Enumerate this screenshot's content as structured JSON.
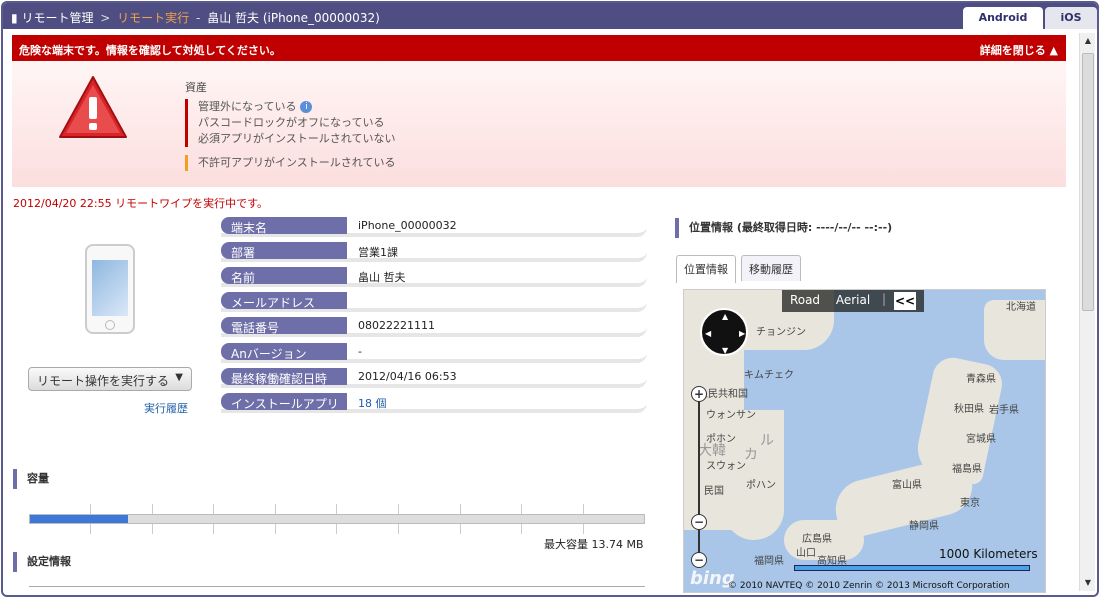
{
  "titlebar": {
    "crumb_root": "リモート管理",
    "crumb_sep": ">",
    "crumb_current": "リモート実行",
    "crumb_dash": "-",
    "device_title": "畠山 哲夫 (iPhone_00000032)"
  },
  "os_tabs": [
    "Android",
    "iOS"
  ],
  "alert": {
    "message": "危険な端末です。情報を確認して対処してください。",
    "close_label": "詳細を閉じる ▲",
    "section_title": "資産",
    "issues_red": [
      "管理外になっている",
      "パスコードロックがオフになっている",
      "必須アプリがインストールされていない"
    ],
    "issues_orange": [
      "不許可アプリがインストールされている"
    ]
  },
  "wipe_message": "2012/04/20 22:55 リモートワイプを実行中です。",
  "remote_action": {
    "label": "リモート操作を実行する",
    "caret": "▼",
    "history_link": "実行履歴"
  },
  "device_info": [
    {
      "label": "端末名",
      "value": "iPhone_00000032"
    },
    {
      "label": "部署",
      "value": "営業1課"
    },
    {
      "label": "名前",
      "value": "畠山 哲夫"
    },
    {
      "label": "メールアドレス",
      "value": ""
    },
    {
      "label": "電話番号",
      "value": "08022221111"
    },
    {
      "label": "Anバージョン",
      "value": "-"
    },
    {
      "label": "最終稼働確認日時",
      "value": "2012/04/16 06:53"
    },
    {
      "label": "インストールアプリ",
      "value": "18 個"
    }
  ],
  "capacity": {
    "title": "容量",
    "used_fraction": 0.16,
    "max_label": "最大容量 13.74 MB"
  },
  "settings": {
    "title": "設定情報"
  },
  "location": {
    "title": "位置情報 (最終取得日時: ----/--/-- --:--)",
    "tabs": [
      "位置情報",
      "移動履歴"
    ],
    "map": {
      "road": "Road",
      "aerial": "Aerial",
      "sep": "|",
      "collapse": "<<",
      "scale": "1000 Kilometers",
      "bing": "bing",
      "copyright": "© 2010 NAVTEQ   © 2010 Zenrin   © 2013 Microsoft Corporation",
      "labels": [
        "北海道",
        "チョンジン",
        "キムチェク",
        "人民共和国",
        "ウォンサン",
        "ポホン",
        "スウォン",
        "ポハン",
        "民国",
        "大韓",
        "ル",
        "カ",
        "青森県",
        "秋田県",
        "岩手県",
        "宮城県",
        "福島県",
        "富山県",
        "東京",
        "静岡県",
        "広島県",
        "高知県",
        "福岡県",
        "山口"
      ]
    }
  }
}
